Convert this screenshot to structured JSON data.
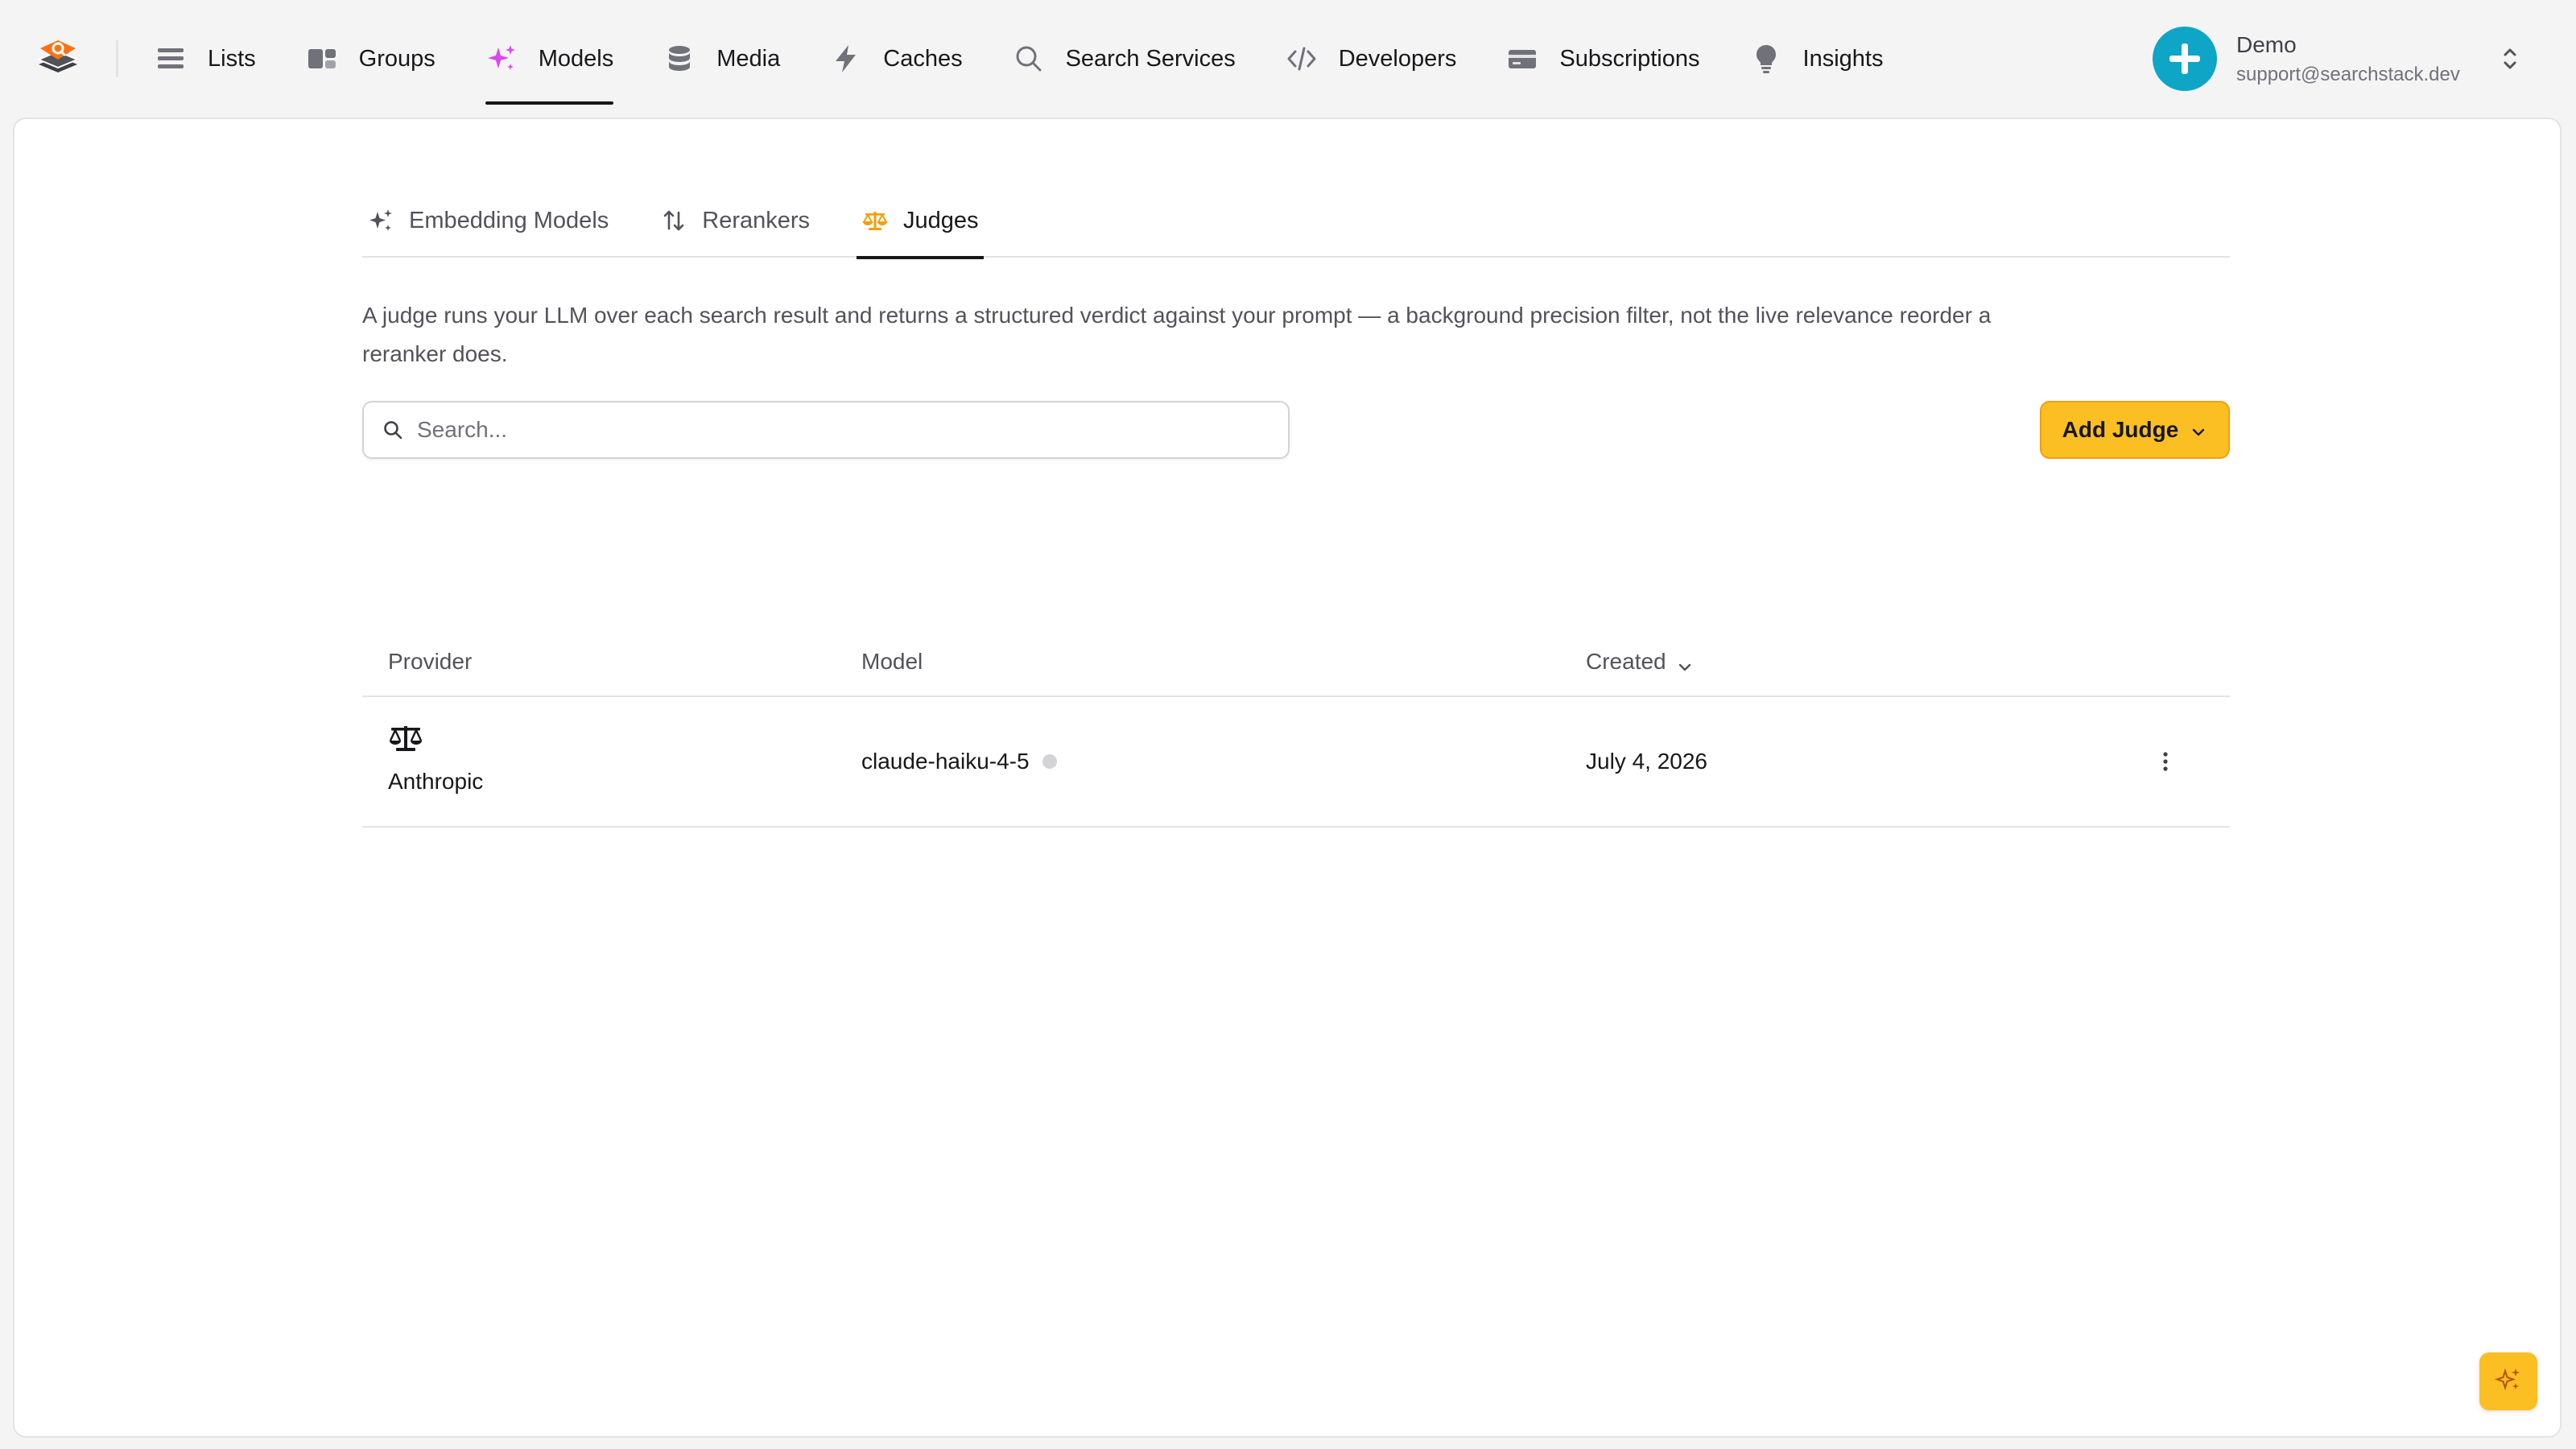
{
  "nav": {
    "items": [
      {
        "label": "Lists",
        "icon": "list-icon"
      },
      {
        "label": "Groups",
        "icon": "groups-icon"
      },
      {
        "label": "Models",
        "icon": "sparkles-icon"
      },
      {
        "label": "Media",
        "icon": "database-icon"
      },
      {
        "label": "Caches",
        "icon": "lightning-icon"
      },
      {
        "label": "Search Services",
        "icon": "search-icon"
      },
      {
        "label": "Developers",
        "icon": "code-icon"
      },
      {
        "label": "Subscriptions",
        "icon": "credit-card-icon"
      },
      {
        "label": "Insights",
        "icon": "lightbulb-icon"
      }
    ],
    "active": "Models"
  },
  "account": {
    "name": "Demo",
    "email": "support@searchstack.dev"
  },
  "tabs": [
    {
      "label": "Embedding Models",
      "icon": "sparkles-icon"
    },
    {
      "label": "Rerankers",
      "icon": "arrows-up-down-icon"
    },
    {
      "label": "Judges",
      "icon": "scale-icon"
    }
  ],
  "active_tab": "Judges",
  "description": "A judge runs your LLM over each search result and returns a structured verdict against your prompt — a background precision filter, not the live relevance reorder a reranker does.",
  "search": {
    "placeholder": "Search..."
  },
  "add_button": {
    "label": "Add Judge"
  },
  "table": {
    "headers": {
      "provider": "Provider",
      "model": "Model",
      "created": "Created"
    },
    "rows": [
      {
        "provider": "Anthropic",
        "model": "claude-haiku-4-5",
        "created": "July 4, 2026"
      }
    ]
  },
  "colors": {
    "accent": "#fbbf24",
    "avatar": "#0ea5c6",
    "models_icon": "#d946ef",
    "judges_icon": "#f59e0b"
  }
}
